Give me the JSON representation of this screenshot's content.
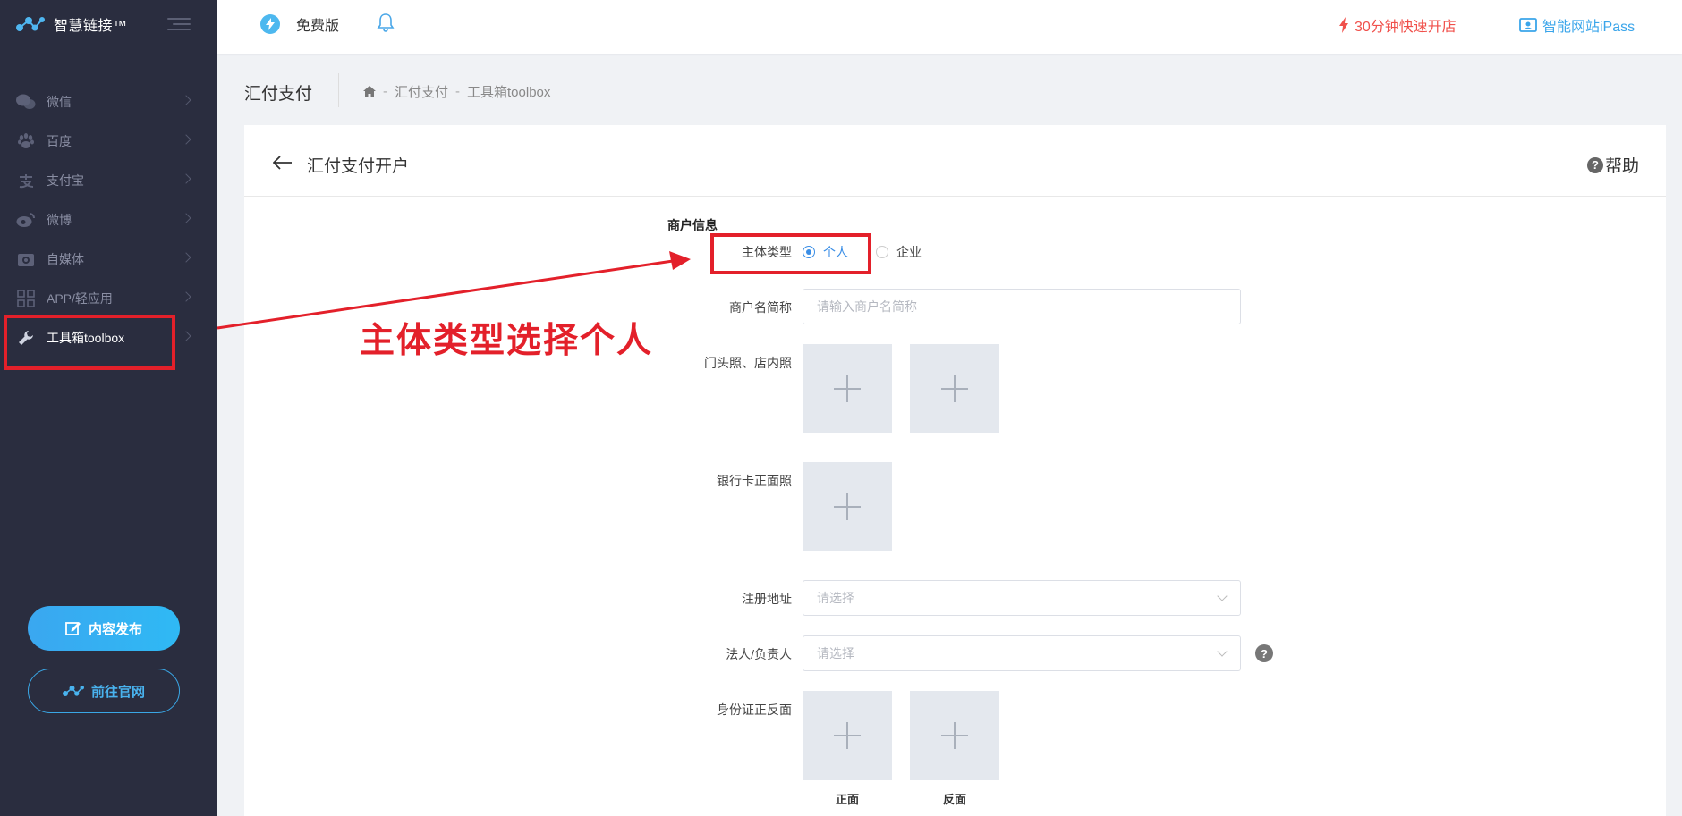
{
  "sidebar": {
    "brand": "智慧链接™",
    "items": [
      {
        "label": "微信",
        "icon": "wechat-icon"
      },
      {
        "label": "百度",
        "icon": "paw-icon"
      },
      {
        "label": "支付宝",
        "icon": "alipay-icon"
      },
      {
        "label": "微博",
        "icon": "weibo-icon"
      },
      {
        "label": "自媒体",
        "icon": "camera-icon"
      },
      {
        "label": "APP/轻应用",
        "icon": "apps-grid-icon"
      },
      {
        "label": "工具箱toolbox",
        "icon": "wrench-icon",
        "active": true
      }
    ],
    "publish_label": "内容发布",
    "site_label": "前往官网"
  },
  "header": {
    "plan": "免费版",
    "promo": "30分钟快速开店",
    "ipass": "智能网站iPass"
  },
  "breadcrumb": {
    "title": "汇付支付",
    "path": [
      "汇付支付",
      "工具箱toolbox"
    ]
  },
  "card": {
    "title": "汇付支付开户",
    "help": "帮助",
    "section": "商户信息",
    "fields": {
      "subject_type": {
        "label": "主体类型",
        "options": [
          "个人",
          "企业"
        ],
        "selected": "个人"
      },
      "merchant_name": {
        "label": "商户名简称",
        "placeholder": "请输入商户名简称"
      },
      "storefront": {
        "label": "门头照、店内照"
      },
      "bank_card": {
        "label": "银行卡正面照"
      },
      "reg_address": {
        "label": "注册地址",
        "placeholder": "请选择"
      },
      "legal_person": {
        "label": "法人/负责人",
        "placeholder": "请选择"
      },
      "id_card": {
        "label": "身份证正反面",
        "front": "正面",
        "back": "反面"
      }
    }
  },
  "annotation": {
    "text": "主体类型选择个人",
    "color": "#e3202a"
  }
}
